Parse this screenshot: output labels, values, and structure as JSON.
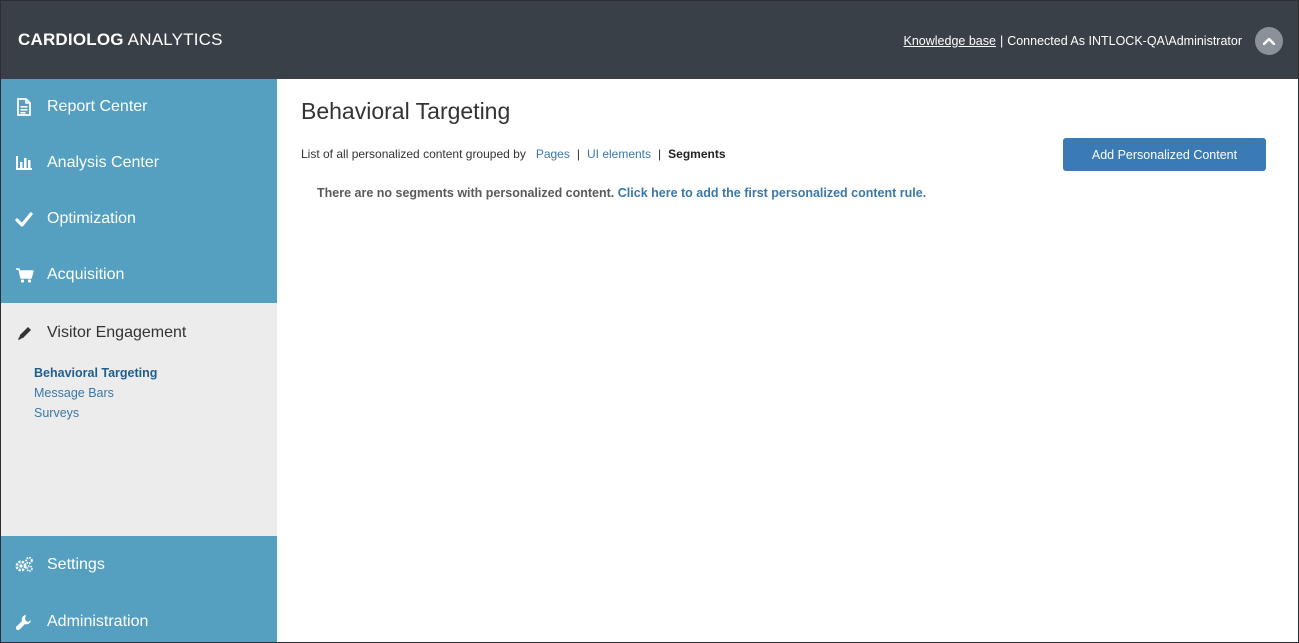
{
  "header": {
    "brand_strong": "CARDIOLOG",
    "brand_rest": " ANALYTICS",
    "knowledge_link": "Knowledge base",
    "separator": "|",
    "connected_text": "Connected As INTLOCK-QA\\Administrator"
  },
  "sidebar": {
    "top_items": [
      {
        "label": "Report Center",
        "icon": "document-icon"
      },
      {
        "label": "Analysis Center",
        "icon": "bar-chart-icon"
      },
      {
        "label": "Optimization",
        "icon": "checkmark-icon"
      },
      {
        "label": "Acquisition",
        "icon": "cart-icon"
      }
    ],
    "active_section": {
      "label": "Visitor Engagement",
      "icon": "pencil-icon",
      "subitems": [
        {
          "label": "Behavioral Targeting",
          "active": true
        },
        {
          "label": "Message Bars",
          "active": false
        },
        {
          "label": "Surveys",
          "active": false
        }
      ]
    },
    "bottom_items": [
      {
        "label": "Settings",
        "icon": "gears-icon"
      },
      {
        "label": "Administration",
        "icon": "wrench-icon"
      }
    ]
  },
  "main": {
    "title": "Behavioral Targeting",
    "group_prefix": "List of all personalized content grouped by",
    "group_links": [
      "Pages",
      "UI elements"
    ],
    "group_current": "Segments",
    "add_button": "Add Personalized Content",
    "empty_text": "There are no segments with personalized content.",
    "empty_link": "Click here to add the first personalized content rule."
  },
  "colors": {
    "topbar": "#3a4047",
    "sidebar_blue": "#55a0c1",
    "sidebar_gray": "#ececec",
    "link_blue": "#3a78a8",
    "button_blue": "#3a7ab5"
  }
}
